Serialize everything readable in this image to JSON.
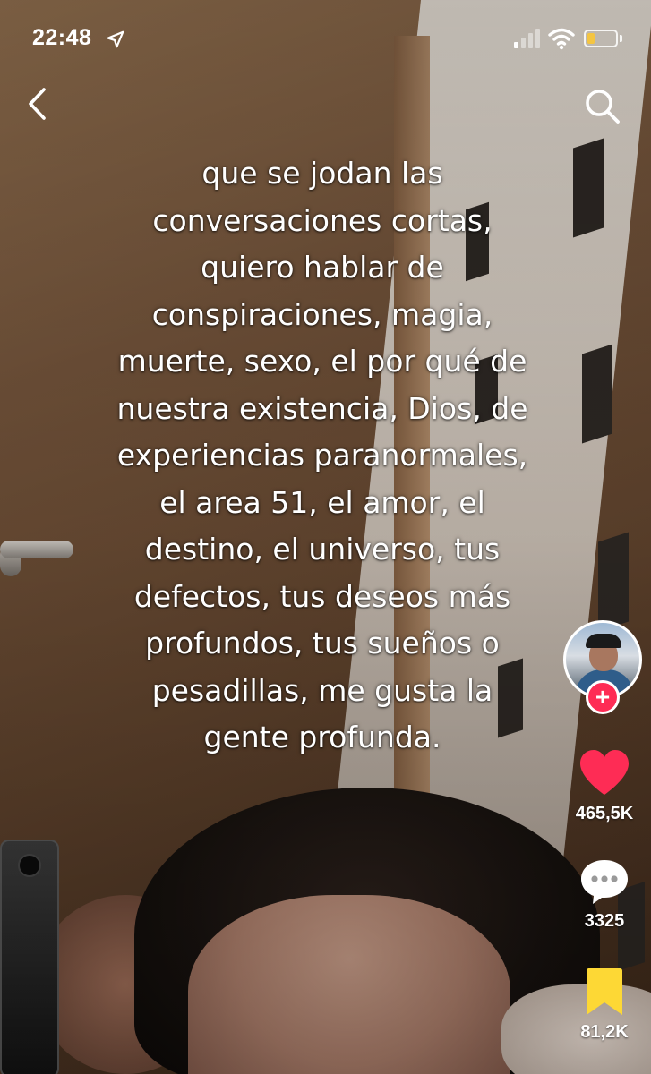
{
  "status_bar": {
    "time": "22:48",
    "battery_level": 0.25,
    "battery_color": "#f4c542"
  },
  "nav": {
    "back_icon": "chevron-left-icon",
    "search_icon": "search-icon"
  },
  "video": {
    "overlay_lines": [
      "que se jodan las",
      "conversaciones cortas,",
      "quiero hablar de",
      "conspiraciones, magia,",
      "muerte, sexo, el por qué de",
      "nuestra existencia, Dios, de",
      "experiencias paranormales,",
      "el area 51, el amor, el",
      "destino, el universo, tus",
      "defectos, tus deseos más",
      "profundos, tus sueños o",
      "pesadillas, me gusta la",
      "gente profunda."
    ]
  },
  "sidebar": {
    "follow_label": "+",
    "like_count": "465,5K",
    "comment_count": "3325",
    "favorite_count": "81,2K",
    "accent_color": "#fe2c55",
    "favorite_color": "#fdd835"
  }
}
